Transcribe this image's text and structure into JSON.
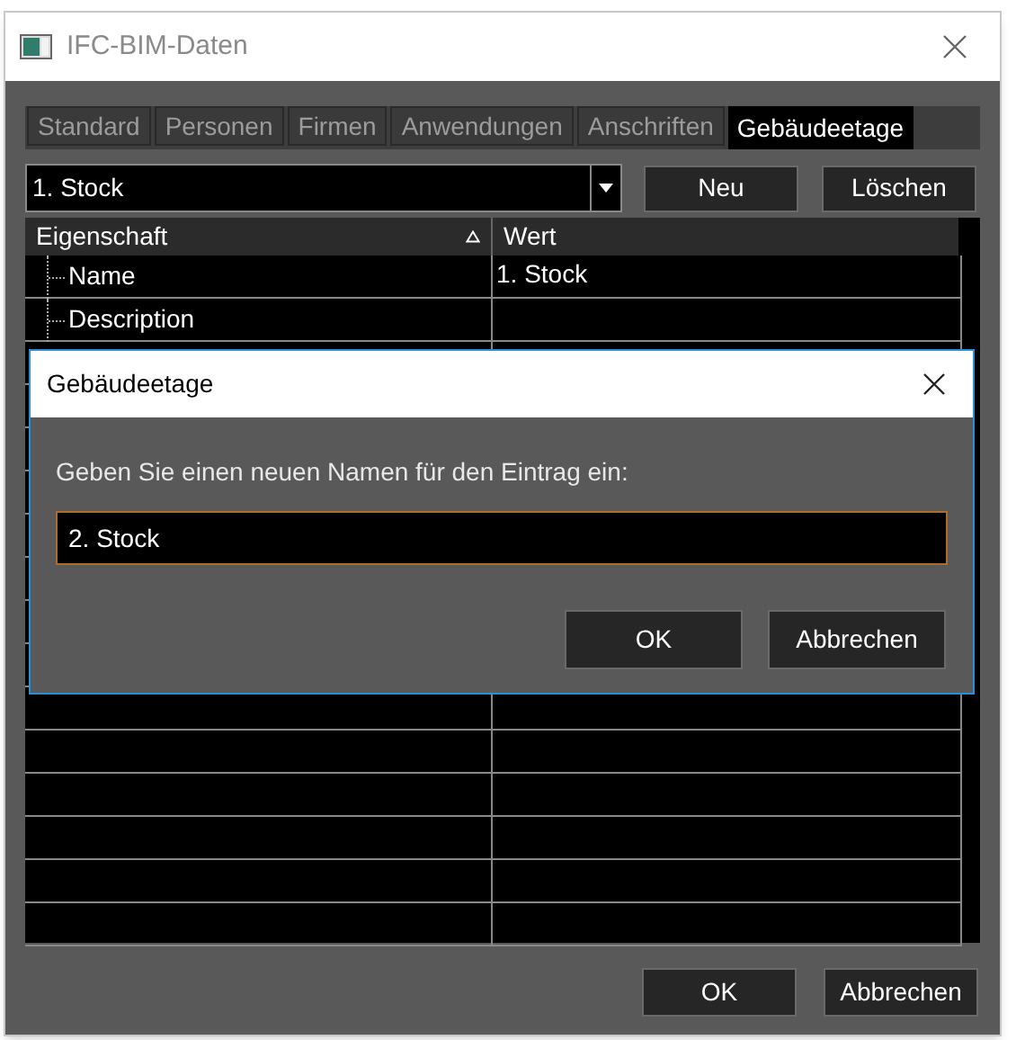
{
  "window": {
    "title": "IFC-BIM-Daten"
  },
  "tabs": [
    {
      "label": "Standard",
      "selected": false
    },
    {
      "label": "Personen",
      "selected": false
    },
    {
      "label": "Firmen",
      "selected": false
    },
    {
      "label": "Anwendungen",
      "selected": false
    },
    {
      "label": "Anschriften",
      "selected": false
    },
    {
      "label": "Gebäudeetage",
      "selected": true
    }
  ],
  "storey_select": {
    "value": "1. Stock"
  },
  "toolbar_buttons": [
    "Neu",
    "Löschen"
  ],
  "table": {
    "columns": [
      "Eigenschaft",
      "Wert"
    ],
    "rows": [
      {
        "property": "Name",
        "value": "1. Stock"
      },
      {
        "property": "Description",
        "value": ""
      }
    ]
  },
  "footer_buttons": [
    "OK",
    "Abbrechen"
  ],
  "dialog": {
    "title": "Gebäudeetage",
    "prompt": "Geben Sie einen neuen Namen für den Eintrag ein:",
    "input": {
      "value": "2. Stock"
    },
    "buttons": [
      "OK",
      "Abbrechen"
    ]
  }
}
